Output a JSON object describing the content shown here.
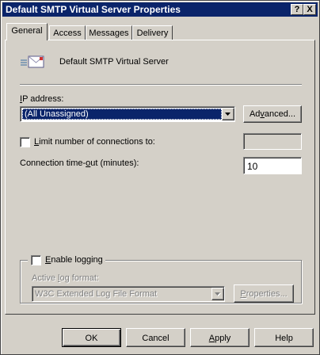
{
  "window": {
    "title": "Default SMTP Virtual Server Properties"
  },
  "caption": {
    "help": "?",
    "close": "X"
  },
  "tabs": [
    {
      "label": "General",
      "active": true
    },
    {
      "label": "Access",
      "active": false
    },
    {
      "label": "Messages",
      "active": false
    },
    {
      "label": "Delivery",
      "active": false
    }
  ],
  "general": {
    "server_name": "Default SMTP Virtual Server",
    "server_icon": "mail-envelope-icon",
    "ip": {
      "label_first": "I",
      "label_rest": "P address:",
      "selected": "(All Unassigned)",
      "advanced_pre": "Ad",
      "advanced_u": "v",
      "advanced_post": "anced..."
    },
    "limit_connections": {
      "label_u": "L",
      "label_rest": "imit number of connections to:",
      "checked": false,
      "value": ""
    },
    "timeout": {
      "label_pre": "Connection time-",
      "label_u": "o",
      "label_post": "ut (minutes):",
      "value": "10"
    },
    "logging": {
      "label_u": "E",
      "label_rest": "nable logging",
      "checked": false,
      "format_label_pre": "Active ",
      "format_label_u": "l",
      "format_label_post": "og format:",
      "format_selected": "W3C Extended Log File Format",
      "properties_pre": "",
      "properties_u": "P",
      "properties_post": "roperties..."
    }
  },
  "footer": {
    "ok": "OK",
    "cancel": "Cancel",
    "apply_u": "A",
    "apply_rest": "pply",
    "help": "Help"
  },
  "colors": {
    "titlebar": "#0a246a",
    "face": "#d4d0c8",
    "selection": "#0a246a"
  }
}
